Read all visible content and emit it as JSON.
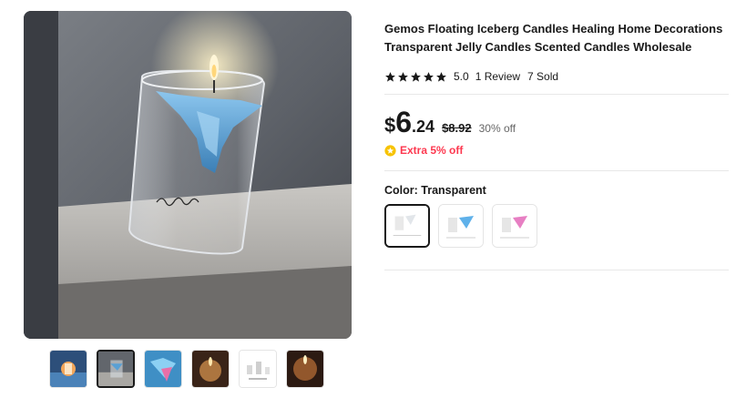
{
  "product": {
    "title": "Gemos Floating Iceberg Candles Healing Home Decorations Transparent Jelly Candles Scented Candles Wholesale",
    "rating": "5.0",
    "reviews": "1 Review",
    "sold": "7 Sold"
  },
  "price": {
    "currency": "$",
    "integer": "6",
    "decimal": ".24",
    "original": "$8.92",
    "discount": "30% off",
    "extra": "Extra 5% off"
  },
  "variant": {
    "label": "Color: Transparent",
    "selected": "Transparent",
    "swatches": [
      "Transparent",
      "Blue",
      "Pink"
    ]
  },
  "gallery": {
    "thumbnail_count": 6,
    "active_index": 1
  },
  "colors": {
    "text": "#191919",
    "promo": "#fd384f",
    "star": "#191919",
    "coin": "#f7c300"
  }
}
